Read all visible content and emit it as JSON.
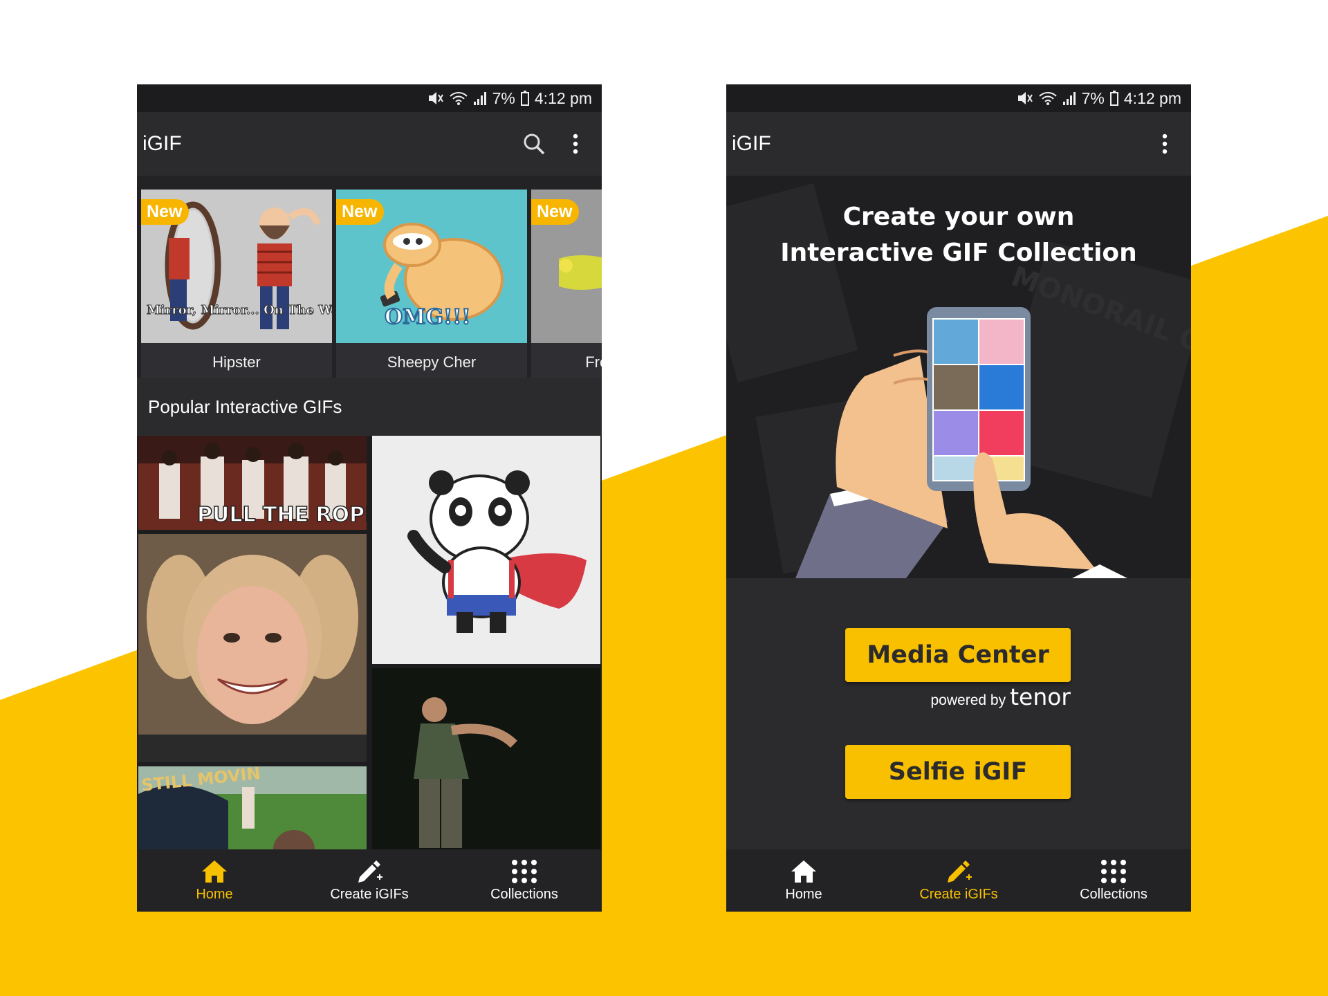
{
  "colors": {
    "accent": "#f9c000",
    "phone_bg": "#2b2b2e",
    "status_bg": "#1c1c1e"
  },
  "status": {
    "battery": "7%",
    "time": "4:12 pm"
  },
  "app": {
    "title": "iGIF"
  },
  "left": {
    "cards": [
      {
        "badge": "New",
        "label": "Hipster",
        "caption": "Mirror, Mirror... On The Wall..."
      },
      {
        "badge": "New",
        "label": "Sheepy Cher",
        "caption": "OMG!!!"
      },
      {
        "badge": "New",
        "label": "Frc"
      }
    ],
    "section_title": "Popular Interactive GIFs",
    "gif_texts": {
      "rope": "PULL THE ROPE",
      "hat": "STILL MOVIN"
    }
  },
  "right": {
    "hero_line1": "Create your own",
    "hero_line2": "Interactive GIF Collection",
    "hero_bg_text": "MONORAIL CAT",
    "media_center": "Media Center",
    "powered_by": "powered by",
    "tenor": "tenor",
    "selfie": "Selfie iGIF"
  },
  "nav": {
    "home": "Home",
    "create": "Create iGIFs",
    "collections": "Collections"
  }
}
